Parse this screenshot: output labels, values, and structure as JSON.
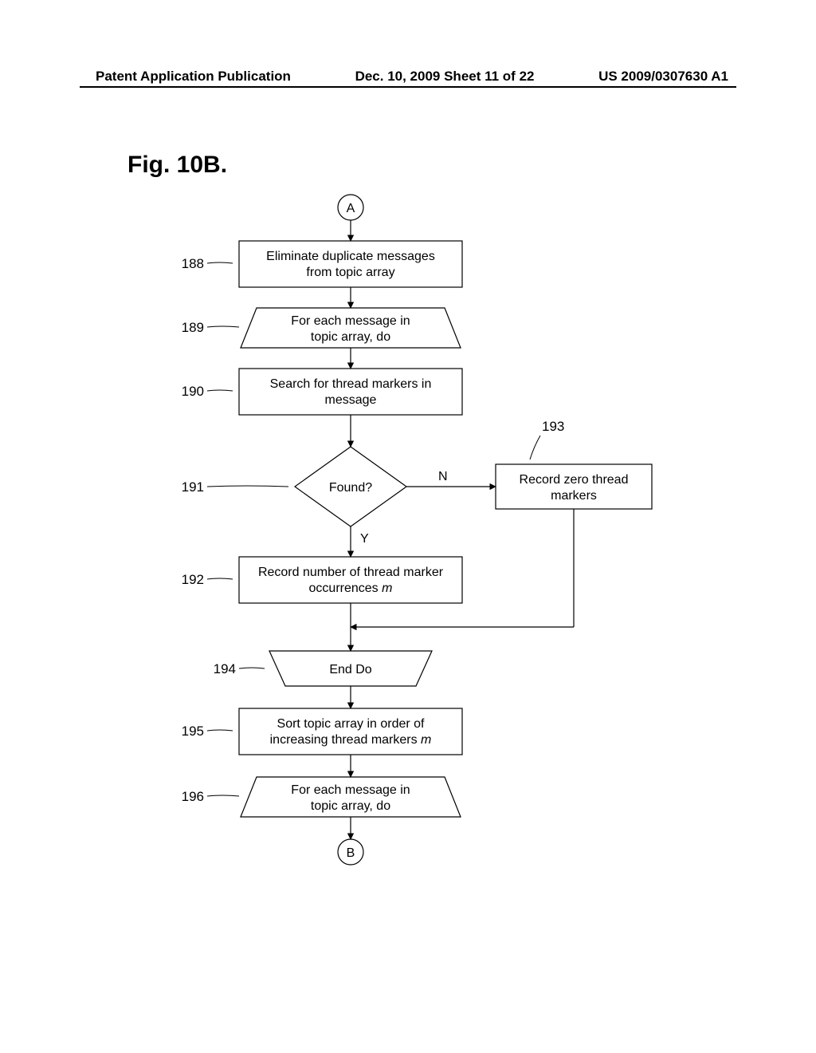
{
  "header": {
    "left": "Patent Application Publication",
    "mid": "Dec. 10, 2009  Sheet 11 of 22",
    "right": "US 2009/0307630 A1"
  },
  "figure_title": "Fig. 10B.",
  "nodes": {
    "connA": "A",
    "connB": "B",
    "n188": {
      "ref": "188",
      "line1": "Eliminate duplicate messages",
      "line2": "from topic array"
    },
    "n189": {
      "ref": "189",
      "line1": "For each message in",
      "line2": "topic array, do"
    },
    "n190": {
      "ref": "190",
      "line1": "Search for thread markers in",
      "line2": "message"
    },
    "n191": {
      "ref": "191",
      "text": "Found?"
    },
    "n192": {
      "ref": "192",
      "line1": "Record number of thread marker",
      "line2a": "occurrences ",
      "line2b": "m"
    },
    "n193": {
      "ref": "193",
      "line1": "Record zero thread",
      "line2": "markers"
    },
    "n194": {
      "ref": "194",
      "text": "End  Do"
    },
    "n195": {
      "ref": "195",
      "line1": "Sort topic array in order of",
      "line2a": "increasing thread markers ",
      "line2b": "m"
    },
    "n196": {
      "ref": "196",
      "line1": "For each message in",
      "line2": "topic array, do"
    }
  },
  "edges": {
    "no": "N",
    "yes": "Y"
  }
}
